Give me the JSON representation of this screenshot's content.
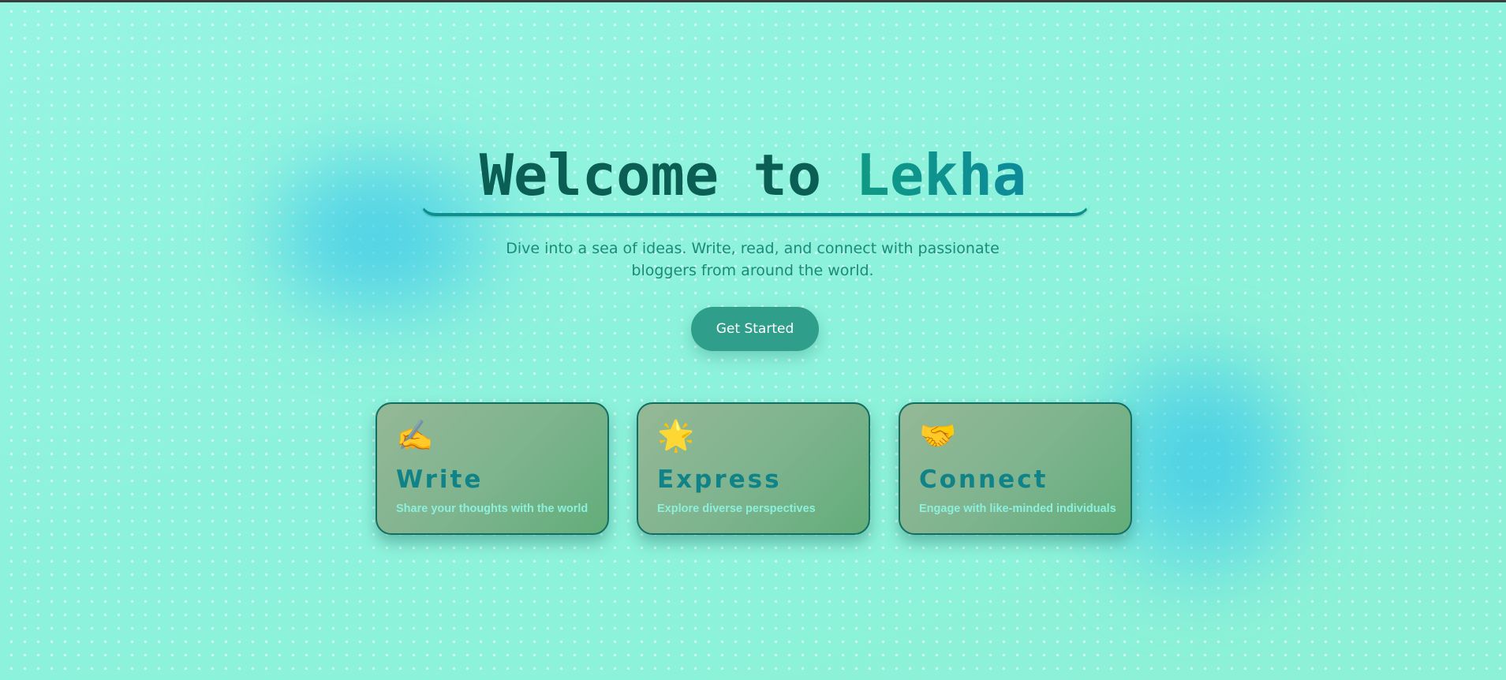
{
  "hero": {
    "title_prefix": "Welcome to ",
    "title_brand": "Lekha",
    "subtitle": "Dive into a sea of ideas. Write, read, and connect with passionate bloggers from around the world.",
    "cta_label": "Get Started"
  },
  "features": [
    {
      "icon": "writing-hand-icon",
      "emoji": "✍️",
      "title": "Write",
      "description": "Share your thoughts with the world"
    },
    {
      "icon": "star-icon",
      "emoji": "🌟",
      "title": "Express",
      "description": "Explore diverse perspectives"
    },
    {
      "icon": "handshake-icon",
      "emoji": "🤝",
      "title": "Connect",
      "description": "Engage with like-minded individuals"
    }
  ],
  "colors": {
    "background": "#8ef3dd",
    "title": "#0b5e53",
    "brand_accent": "#0f9a84",
    "cta": "#2f9e8a",
    "card_border": "#136e62",
    "card_title": "#0f8388",
    "card_text": "#8cf0dc",
    "blob": "#34c4e9"
  }
}
